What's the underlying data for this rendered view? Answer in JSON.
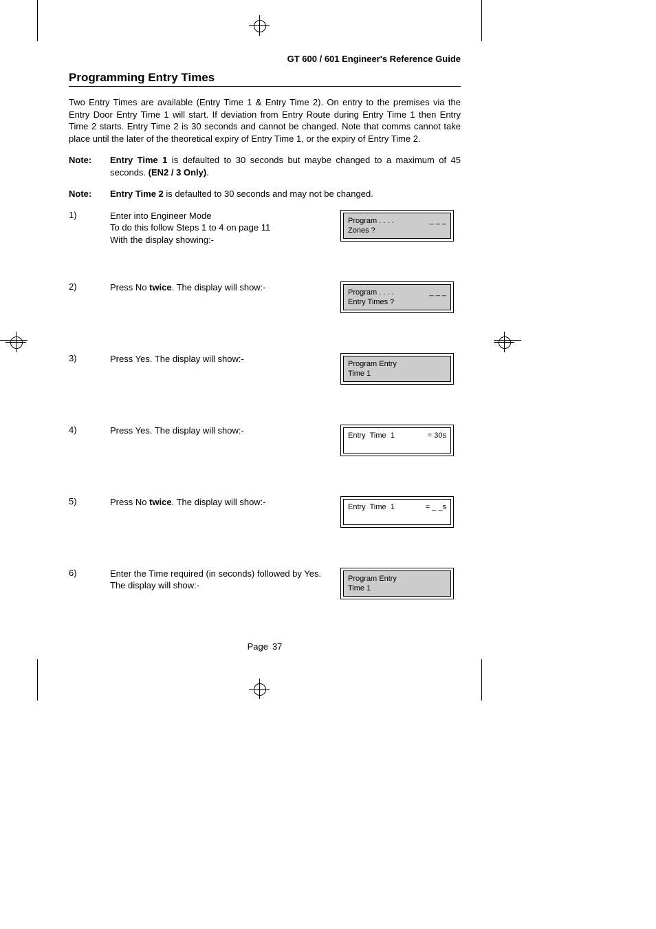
{
  "header": {
    "running_head": "GT 600 / 601 Engineer's Reference Guide"
  },
  "section": {
    "title": "Programming Entry Times",
    "intro": "Two Entry Times are available (Entry Time 1 & Entry Time 2). On entry to the premises via the Entry Door Entry Time 1 will start. If deviation from Entry Route during Entry Time 1 then Entry Time 2 starts. Entry Time 2 is 30 seconds and cannot be changed. Note that comms cannot take place until the later of the theoretical expiry of Entry Time 1, or the expiry of Entry Time 2."
  },
  "notes": [
    {
      "label": "Note:",
      "lead": "Entry Time 1",
      "mid": " is defaulted to 30 seconds but maybe changed to a maximum of 45 seconds. ",
      "tail_bold": "(EN2 / 3 Only)",
      "tail": "."
    },
    {
      "label": "Note:",
      "lead": "Entry Time 2",
      "mid": " is defaulted to 30 seconds and may not be changed.",
      "tail_bold": "",
      "tail": ""
    }
  ],
  "steps": [
    {
      "num": "1)",
      "text_pre": "Enter into Engineer Mode\nTo do this follow Steps 1 to 4 on page 11\nWith the display showing:-",
      "text_bold": "",
      "text_post": "",
      "lcd_grey": true,
      "lcd_line1_left": "Program . . . .",
      "lcd_line1_right": "_ _ _",
      "lcd_line2": "Zones ?"
    },
    {
      "num": "2)",
      "text_pre": "Press No ",
      "text_bold": "twice",
      "text_post": ". The display will show:-",
      "lcd_grey": true,
      "lcd_line1_left": "Program . . . .",
      "lcd_line1_right": "_ _ _",
      "lcd_line2": "Entry Times ?"
    },
    {
      "num": "3)",
      "text_pre": "Press Yes. The display will show:-",
      "text_bold": "",
      "text_post": "",
      "lcd_grey": true,
      "lcd_line1_left": "Program Entry",
      "lcd_line1_right": "",
      "lcd_line2": "Time 1"
    },
    {
      "num": "4)",
      "text_pre": "Press Yes. The display will show:-",
      "text_bold": "",
      "text_post": "",
      "lcd_grey": false,
      "lcd_line1_left": "Entry  Time  1",
      "lcd_line1_right": "= 30s",
      "lcd_line2": ""
    },
    {
      "num": "5)",
      "text_pre": "Press No ",
      "text_bold": "twice",
      "text_post": ". The display will show:-",
      "lcd_grey": false,
      "lcd_line1_left": "Entry  Time  1",
      "lcd_line1_right": "= _ _s",
      "lcd_line2": ""
    },
    {
      "num": "6)",
      "text_pre": "Enter the Time required (in seconds) followed by Yes. The display will show:-",
      "text_bold": "",
      "text_post": "",
      "lcd_grey": true,
      "lcd_line1_left": "Program Entry",
      "lcd_line1_right": "",
      "lcd_line2": "Time 1"
    }
  ],
  "footer": {
    "page_label": "Page",
    "page_number": "37"
  }
}
